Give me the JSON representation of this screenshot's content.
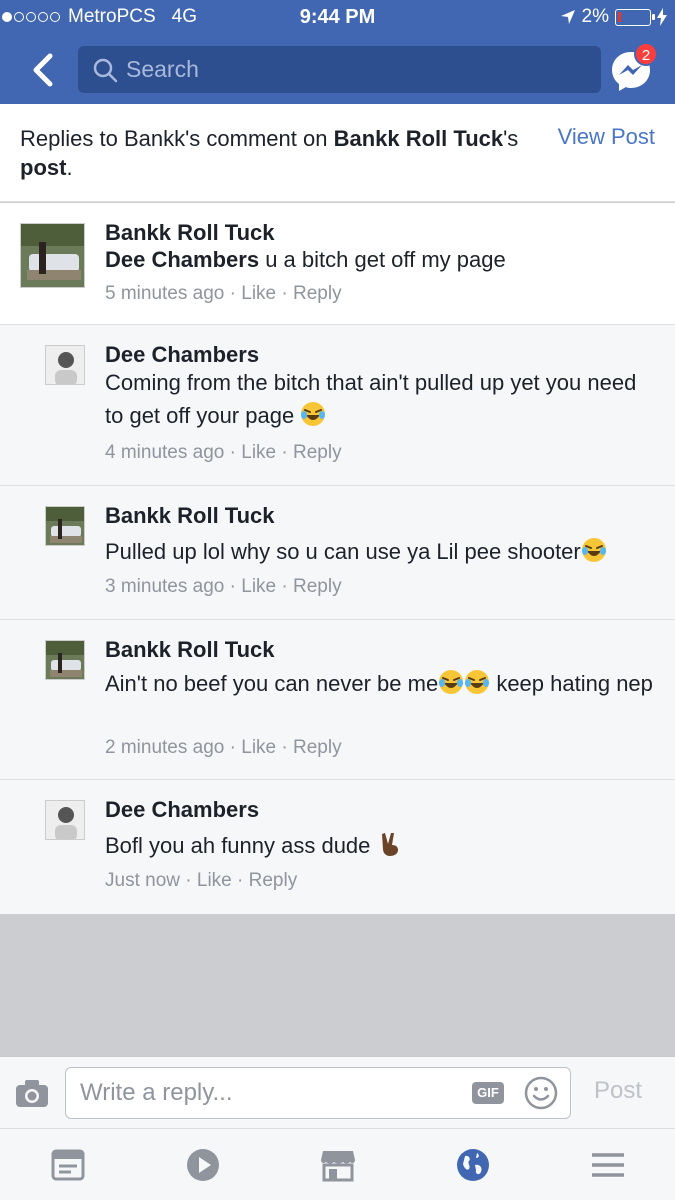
{
  "status_bar": {
    "carrier": "MetroPCS",
    "network": "4G",
    "time": "9:44 PM",
    "battery": "2%"
  },
  "nav": {
    "search_placeholder": "Search",
    "messenger_badge": "2"
  },
  "replies_header": {
    "prefix": "Replies to Bankk's comment on ",
    "owner_bold": "Bankk Roll Tuck",
    "possessive": "'s ",
    "post_bold": "post",
    "suffix": ".",
    "view_post": "View Post"
  },
  "comments": [
    {
      "name": "Bankk Roll Tuck",
      "mention": "Dee Chambers",
      "text": " u a bitch get off my page",
      "time": "5 minutes ago"
    },
    {
      "name": "Dee Chambers",
      "text": "Coming from the bitch that ain't pulled up yet you need to get off your page",
      "time": "4 minutes ago"
    },
    {
      "name": "Bankk Roll Tuck",
      "text": "Pulled up lol why so u can use ya Lil pee shooter",
      "time": "3 minutes ago"
    },
    {
      "name": "Bankk Roll Tuck",
      "text_a": "Ain't no beef you can never be me",
      "text_b": " keep hating nep",
      "time": "2 minutes ago"
    },
    {
      "name": "Dee Chambers",
      "text": "Bofl you ah funny ass dude ",
      "time": "Just now"
    }
  ],
  "actions": {
    "like": "Like",
    "reply": "Reply",
    "sep": " · "
  },
  "composer": {
    "placeholder": "Write a reply...",
    "gif": "GIF",
    "post": "Post"
  },
  "colors": {
    "brand": "#4267b2",
    "link": "#4a76c8",
    "meta": "#90949c",
    "badge": "#fa3e3e"
  },
  "icons": [
    "back-chevron-icon",
    "search-icon",
    "messenger-icon",
    "camera-icon",
    "smiley-icon",
    "news-feed-icon",
    "video-icon",
    "marketplace-icon",
    "globe-icon",
    "menu-icon",
    "laughing-emoji-icon",
    "victory-hand-emoji-icon"
  ]
}
